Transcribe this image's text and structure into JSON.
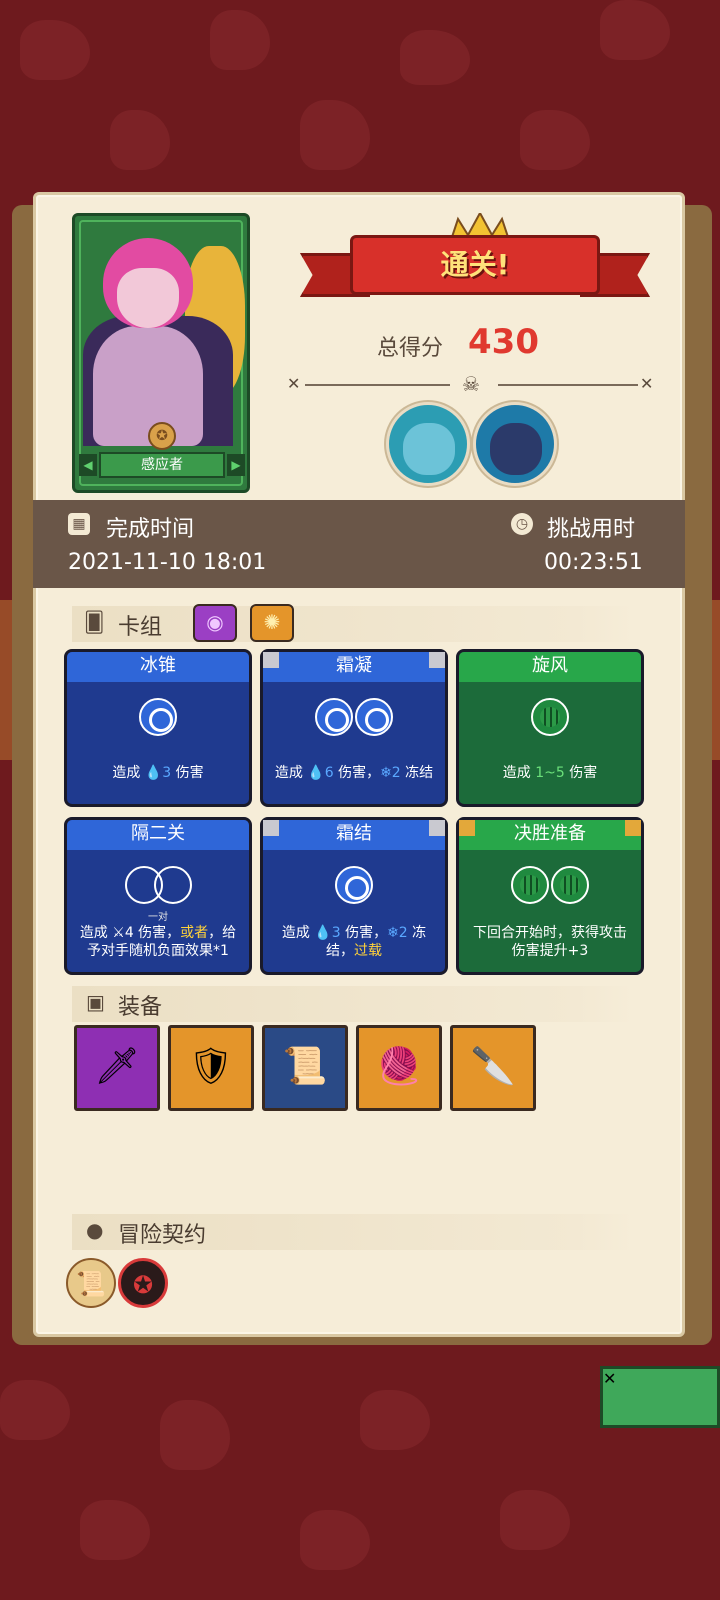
{
  "result": {
    "title": "通关!",
    "score_label": "总得分",
    "score_value": "430"
  },
  "hero": {
    "name": "感应者"
  },
  "times": {
    "finish_label": "完成时间",
    "finish_value": "2021-11-10  18:01",
    "duration_label": "挑战用时",
    "duration_value": "00:23:51"
  },
  "deck": {
    "title": "卡组",
    "cards": [
      {
        "name": "冰锥",
        "color": "blue",
        "orbs": [
          "blue"
        ],
        "desc_a": "造成 ",
        "desc_hl": "💧3",
        "desc_b": " 伤害"
      },
      {
        "name": "霜凝",
        "color": "blue",
        "orbs": [
          "blue",
          "blue"
        ],
        "desc_a": "造成 ",
        "desc_hl": "💧6",
        "desc_b": " 伤害，",
        "desc_hl2": "❄2",
        "desc_c": " 冻结"
      },
      {
        "name": "旋风",
        "color": "green",
        "orbs": [
          "green"
        ],
        "desc_a": "造成 ",
        "desc_hl": "1~5",
        "desc_b": " 伤害"
      },
      {
        "name": "隔二关",
        "color": "blue",
        "orbs": [
          "hollow",
          "hollow"
        ],
        "sublabel": "一对",
        "desc_a": "造成 ⚔4 伤害，",
        "desc_hl": "或者",
        "desc_b": "，给予对手随机负面效果*1"
      },
      {
        "name": "霜结",
        "color": "blue",
        "orbs": [
          "blue"
        ],
        "desc_a": "造成 ",
        "desc_hl": "💧3",
        "desc_b": " 伤害，",
        "desc_hl2": "❄2",
        "desc_c": " 冻结，",
        "desc_hl3": "过载"
      },
      {
        "name": "决胜准备",
        "color": "green",
        "orbs": [
          "green",
          "green"
        ],
        "desc_a": "下回合开始时，获得攻击伤害提升+3"
      }
    ]
  },
  "equipment": {
    "title": "装备",
    "items": [
      {
        "name": "dagger-icon",
        "glyph": "🗡",
        "bg": "#8e2fb3"
      },
      {
        "name": "shield-icon",
        "glyph": "🛡",
        "bg": "#e4952a"
      },
      {
        "name": "scroll-icon",
        "glyph": "📜",
        "bg": "#2a4a86"
      },
      {
        "name": "sweater-icon",
        "glyph": "🧶",
        "bg": "#e4952a"
      },
      {
        "name": "saw-blade-icon",
        "glyph": "🔪",
        "bg": "#e4952a"
      }
    ]
  },
  "contract": {
    "title": "冒险契约"
  },
  "colors": {
    "background": "#6e1a1e",
    "panel": "#f6edd8",
    "score": "#e0392f",
    "time_bar": "#6a5648"
  }
}
